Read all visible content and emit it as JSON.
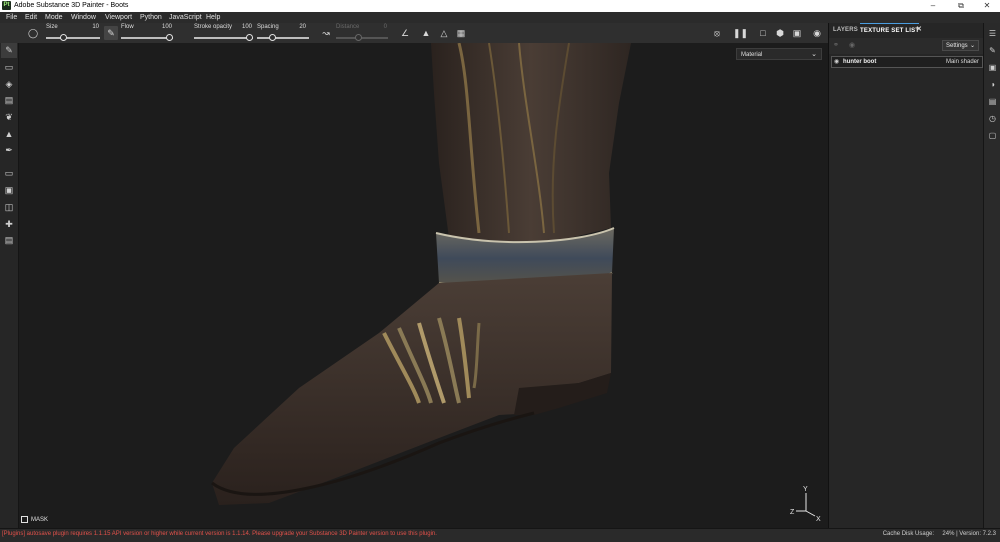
{
  "window": {
    "app_icon": "Pt",
    "title": "Adobe Substance 3D Painter - Boots",
    "controls": [
      "minimize-icon",
      "maximize-icon",
      "close-icon"
    ]
  },
  "menu": [
    "File",
    "Edit",
    "Mode",
    "Window",
    "Viewport",
    "Python",
    "JavaScript",
    "Help"
  ],
  "tool_options": {
    "size": {
      "label": "Size",
      "value": "10"
    },
    "flow": {
      "label": "Flow",
      "value": "100"
    },
    "stroke_opacity": {
      "label": "Stroke opacity",
      "value": "100"
    },
    "spacing": {
      "label": "Spacing",
      "value": "20"
    },
    "distance": {
      "label": "Distance",
      "value": "0"
    }
  },
  "viewport": {
    "display_mode": "Material",
    "mask_label": "MASK",
    "gizmo": {
      "y": "Y",
      "z": "Z",
      "x": "X"
    }
  },
  "panel": {
    "tabs": [
      "LAYERS",
      "TEXTURE SET LIST"
    ],
    "settings_label": "Settings",
    "texture_set": {
      "name": "hunter boot",
      "shader": "Main shader"
    }
  },
  "status": {
    "error": "[Plugins] autosave plugin requires 1.1.15 API version or higher while current version is 1.1.14. Please upgrade your Substance 3D Painter version to use this plugin.",
    "cache_label": "Cache Disk Usage:",
    "cache_value": "24%",
    "version": "| Version: 7.2.3"
  },
  "colors": {
    "accent": "#4a9de0",
    "error": "#e2514a",
    "leather": "#3a2f2a",
    "metal": "#8a7a55"
  }
}
